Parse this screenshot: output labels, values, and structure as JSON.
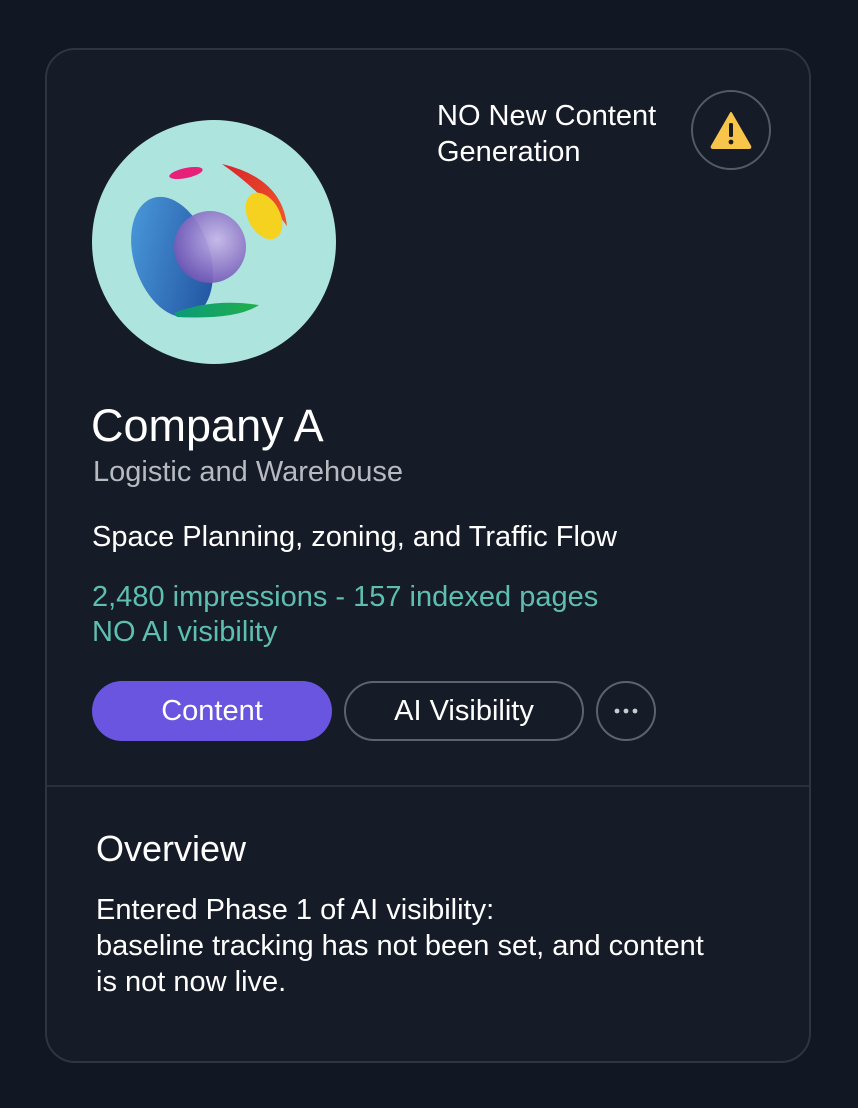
{
  "alert": {
    "text_line1": "NO New Content",
    "text_line2": "Generation",
    "icon": "warning-icon",
    "icon_color": "#f6c54a"
  },
  "company": {
    "name": "Company A",
    "industry": "Logistic and Warehouse",
    "topic": "Space Planning, zoning, and Traffic Flow",
    "logo_background": "#ade4dd"
  },
  "stats": {
    "impressions_line": "2,480 impressions - 157 indexed pages",
    "visibility_line": "NO AI visibility"
  },
  "actions": {
    "content_label": "Content",
    "ai_visibility_label": "AI Visibility",
    "more_icon": "more-horizontal-icon"
  },
  "overview": {
    "title": "Overview",
    "line1": "Entered Phase 1 of AI visibility:",
    "line2": "baseline tracking has not been set, and content",
    "line3": "is not now live."
  },
  "colors": {
    "page_background": "#111723",
    "card_background": "#161b28",
    "accent": "#6a55e0",
    "stats_text": "#5fbfae"
  }
}
